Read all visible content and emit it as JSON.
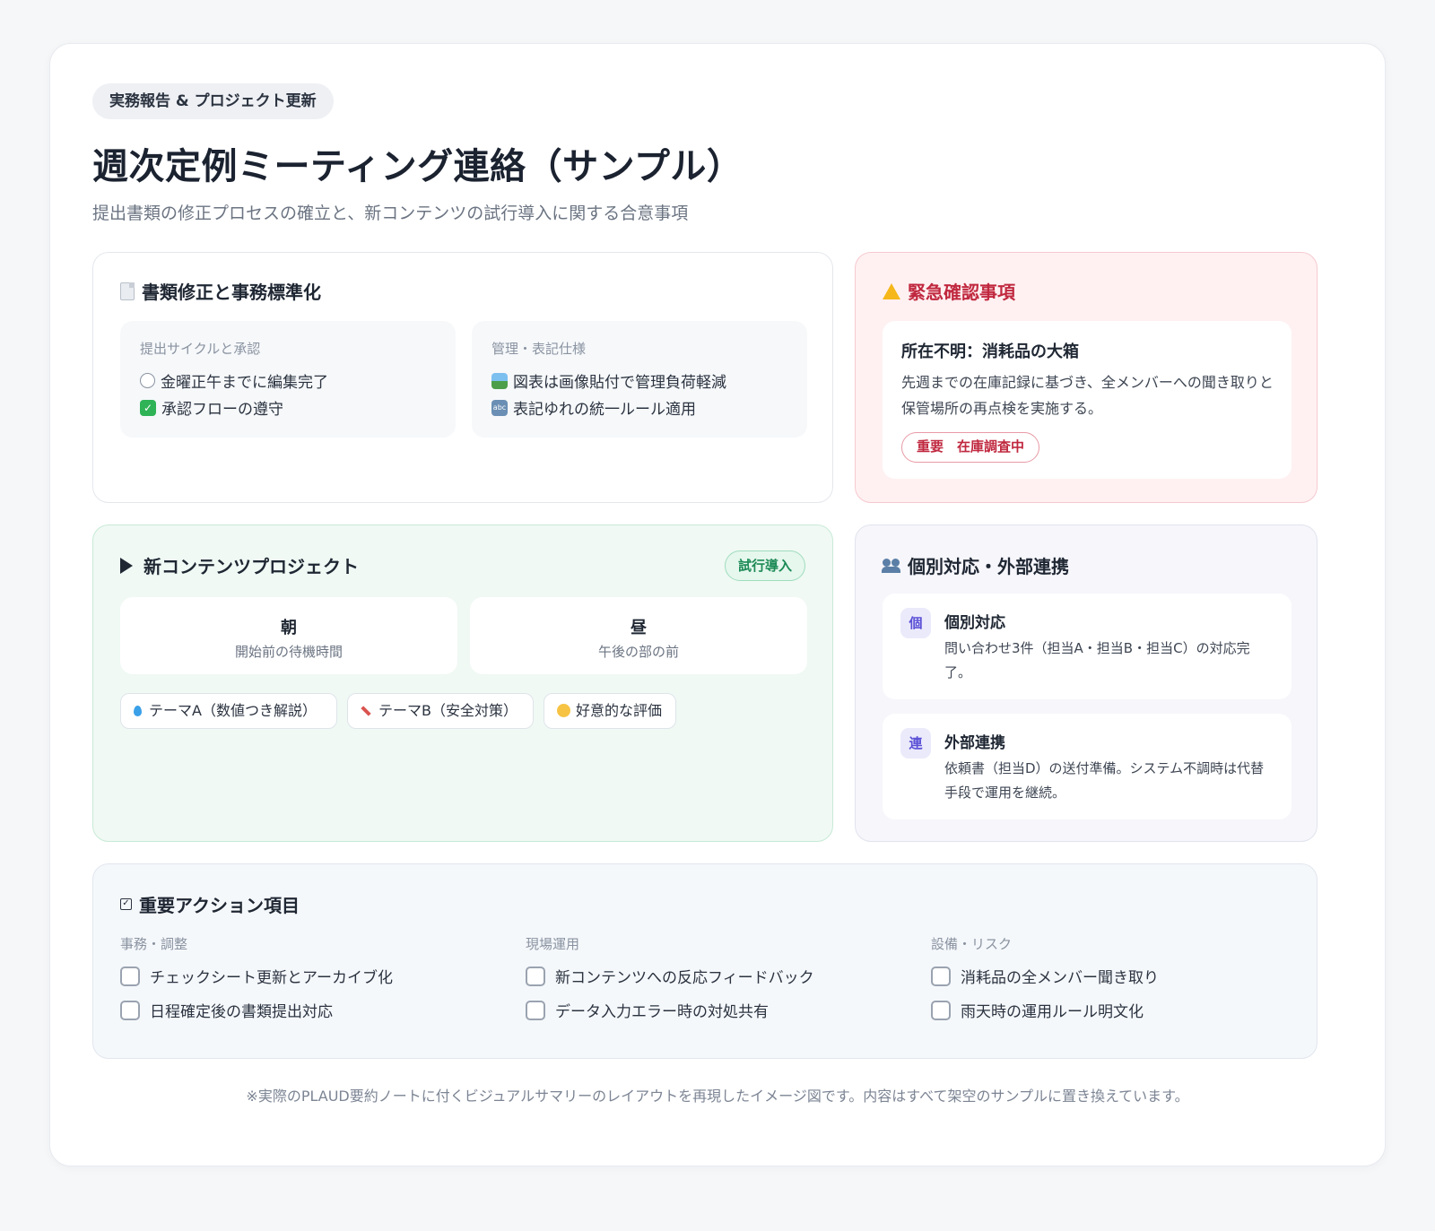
{
  "header": {
    "tag": "実務報告 & プロジェクト更新",
    "title": "週次定例ミーティング連絡（サンプル）",
    "subtitle": "提出書類の修正プロセスの確立と、新コンテンツの試行導入に関する合意事項"
  },
  "documents": {
    "title": "書類修正と事務標準化",
    "icon": "document-icon",
    "sections": [
      {
        "label": "提出サイクルと承認",
        "items": [
          "金曜正午までに編集完了",
          "承認フローの遵守"
        ]
      },
      {
        "label": "管理・表記仕様",
        "items": [
          "図表は画像貼付で管理負荷軽減",
          "表記ゆれの統一ルール適用"
        ]
      }
    ]
  },
  "urgent": {
    "title": "緊急確認事項",
    "item_title": "所在不明：消耗品の大箱",
    "item_text": "先週までの在庫記録に基づき、全メンバーへの聞き取りと保管場所の再点検を実施する。",
    "badge": "重要　在庫調査中",
    "color": "#c0283f"
  },
  "project": {
    "title": "新コンテンツプロジェクト",
    "status": "試行導入",
    "slots": [
      {
        "name": "朝",
        "desc": "開始前の待機時間"
      },
      {
        "name": "昼",
        "desc": "午後の部の前"
      }
    ],
    "chips": [
      "テーマA（数値つき解説）",
      "テーマB（安全対策）",
      "好意的な評価"
    ]
  },
  "individual": {
    "title": "個別対応・外部連携",
    "items": [
      {
        "badge": "個",
        "title": "個別対応",
        "text": "問い合わせ3件（担当A・担当B・担当C）の対応完了。"
      },
      {
        "badge": "連",
        "title": "外部連携",
        "text": "依頼書（担当D）の送付準備。システム不調時は代替手段で運用を継続。"
      }
    ]
  },
  "actions": {
    "title": "重要アクション項目",
    "columns": [
      {
        "label": "事務・調整",
        "items": [
          "チェックシート更新とアーカイブ化",
          "日程確定後の書類提出対応"
        ]
      },
      {
        "label": "現場運用",
        "items": [
          "新コンテンツへの反応フィードバック",
          "データ入力エラー時の対処共有"
        ]
      },
      {
        "label": "設備・リスク",
        "items": [
          "消耗品の全メンバー聞き取り",
          "雨天時の運用ルール明文化"
        ]
      }
    ]
  },
  "footer": "※実際のPLAUD要約ノートに付くビジュアルサマリーのレイアウトを再現したイメージ図です。内容はすべて架空のサンプルに置き換えています。"
}
